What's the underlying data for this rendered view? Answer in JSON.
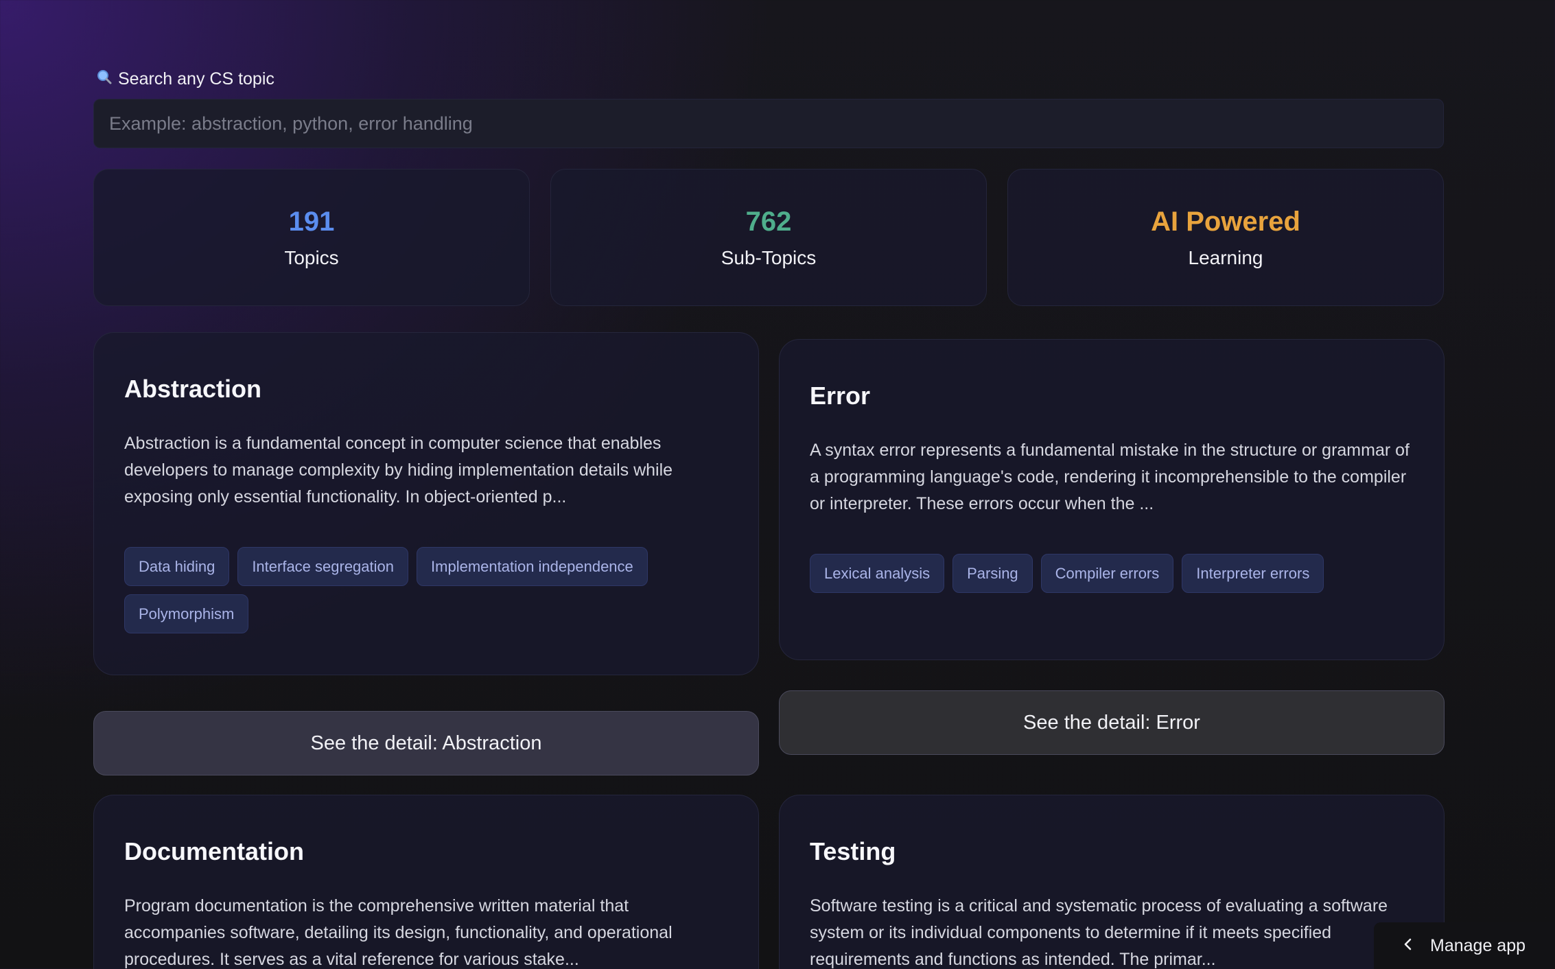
{
  "search": {
    "label": "Search any CS topic",
    "icon": "magnifier-icon",
    "placeholder": "Example: abstraction, python, error handling",
    "value": ""
  },
  "stats": [
    {
      "value": "191",
      "label": "Topics",
      "color": "#5b8def"
    },
    {
      "value": "762",
      "label": "Sub-Topics",
      "color": "#4fae8c"
    },
    {
      "value": "AI Powered",
      "label": "Learning",
      "color": "#e8a33d"
    }
  ],
  "topics": [
    {
      "title": "Abstraction",
      "description": "Abstraction is a fundamental concept in computer science that enables developers to manage complexity by hiding implementation details while exposing only essential functionality. In object-oriented p...",
      "tags": [
        "Data hiding",
        "Interface segregation",
        "Implementation independence",
        "Polymorphism"
      ],
      "button": "See the detail: Abstraction"
    },
    {
      "title": "Error",
      "description": "A syntax error represents a fundamental mistake in the structure or grammar of a programming language's code, rendering it incomprehensible to the compiler or interpreter. These errors occur when the ...",
      "tags": [
        "Lexical analysis",
        "Parsing",
        "Compiler errors",
        "Interpreter errors"
      ],
      "button": "See the detail: Error"
    },
    {
      "title": "Documentation",
      "description": "Program documentation is the comprehensive written material that accompanies software, detailing its design, functionality, and operational procedures. It serves as a vital reference for various stake..."
    },
    {
      "title": "Testing",
      "description": "Software testing is a critical and systematic process of evaluating a software system or its individual components to determine if it meets specified requirements and functions as intended. The primar..."
    }
  ],
  "manage_app": {
    "label": "Manage app",
    "icon": "chevron-left-icon"
  }
}
